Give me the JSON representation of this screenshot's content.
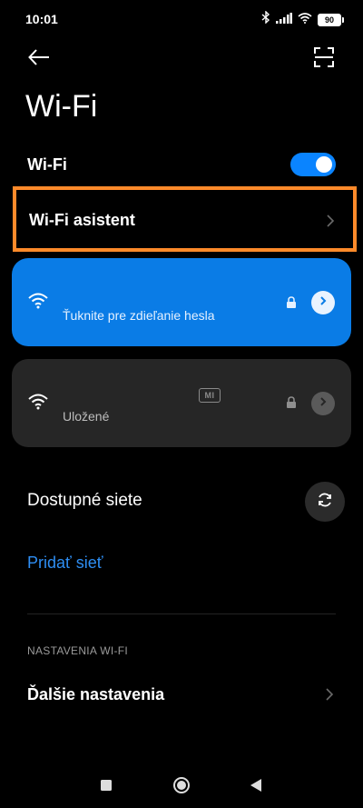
{
  "status_bar": {
    "time": "10:01",
    "battery": "90",
    "icons": [
      "bluetooth-icon",
      "signal-icon",
      "wifi-icon",
      "battery-icon"
    ]
  },
  "top_bar": {
    "back_icon": "back-arrow-icon",
    "scan_icon": "qr-scan-icon"
  },
  "page": {
    "title": "Wi-Fi"
  },
  "wifi_toggle": {
    "label": "Wi-Fi",
    "enabled": true
  },
  "assistant": {
    "label": "Wi-Fi asistent",
    "highlight_color": "#ff8a2a"
  },
  "networks": [
    {
      "subtitle": "Ťuknite pre zdieľanie hesla",
      "state": "connected",
      "secured": true,
      "card_color": "#0a7ce6"
    },
    {
      "subtitle": "Uložené",
      "state": "saved",
      "secured": true,
      "badge": "MI",
      "card_color": "#262626"
    }
  ],
  "available": {
    "label": "Dostupné siete",
    "refresh_icon": "refresh-icon"
  },
  "add_network": {
    "label": "Pridať sieť",
    "color": "#2e8ef3"
  },
  "settings_section": {
    "header": "NASTAVENIA WI-FI",
    "more_settings": "Ďalšie nastavenia"
  },
  "nav_bar": {
    "icons": [
      "recent-apps-icon",
      "home-icon",
      "back-icon"
    ]
  },
  "colors": {
    "background": "#000000",
    "accent": "#0a84ff"
  }
}
